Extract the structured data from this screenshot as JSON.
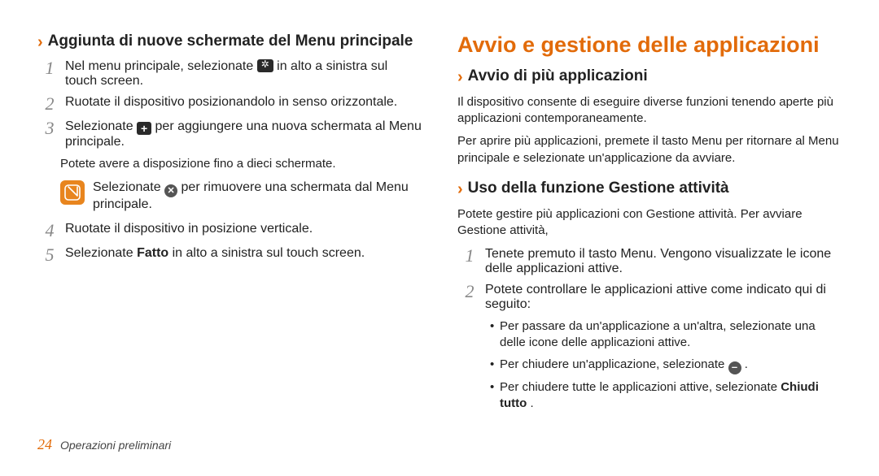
{
  "left": {
    "heading": "Aggiunta di nuove schermate del Menu principale",
    "step1_a": "Nel menu principale, selezionate ",
    "step1_b": " in alto a sinistra sul touch screen.",
    "step2": "Ruotate il dispositivo posizionandolo in senso orizzontale.",
    "step3_a": "Selezionate ",
    "step3_b": " per aggiungere una nuova schermata al Menu principale.",
    "step3_note": "Potete avere a disposizione fino a dieci schermate.",
    "tip_a": "Selezionate ",
    "tip_b": " per rimuovere una schermata dal Menu principale.",
    "step4": "Ruotate il dispositivo in posizione verticale.",
    "step5_a": "Selezionate ",
    "step5_bold": "Fatto",
    "step5_b": " in alto a sinistra sul touch screen."
  },
  "right": {
    "h1": "Avvio e gestione delle applicazioni",
    "sec1_heading": "Avvio di più applicazioni",
    "sec1_p1": "Il dispositivo consente di eseguire diverse funzioni tenendo aperte più applicazioni contemporaneamente.",
    "sec1_p2": "Per aprire più applicazioni, premete il tasto Menu per ritornare al Menu principale e selezionate un'applicazione da avviare.",
    "sec2_heading": "Uso della funzione Gestione attività",
    "sec2_p1": "Potete gestire più applicazioni con Gestione attività. Per avviare Gestione attività,",
    "sec2_step1": "Tenete premuto il tasto Menu. Vengono visualizzate le icone delle applicazioni attive.",
    "sec2_step2": "Potete controllare le applicazioni attive come indicato qui di seguito:",
    "sec2_b1": "Per passare da un'applicazione a un'altra, selezionate una delle icone delle applicazioni attive.",
    "sec2_b2_a": "Per chiudere un'applicazione, selezionate ",
    "sec2_b2_b": ".",
    "sec2_b3_a": "Per chiudere tutte le applicazioni attive, selezionate ",
    "sec2_b3_bold": "Chiudi tutto",
    "sec2_b3_b": "."
  },
  "footer": {
    "page": "24",
    "section": "Operazioni preliminari"
  }
}
